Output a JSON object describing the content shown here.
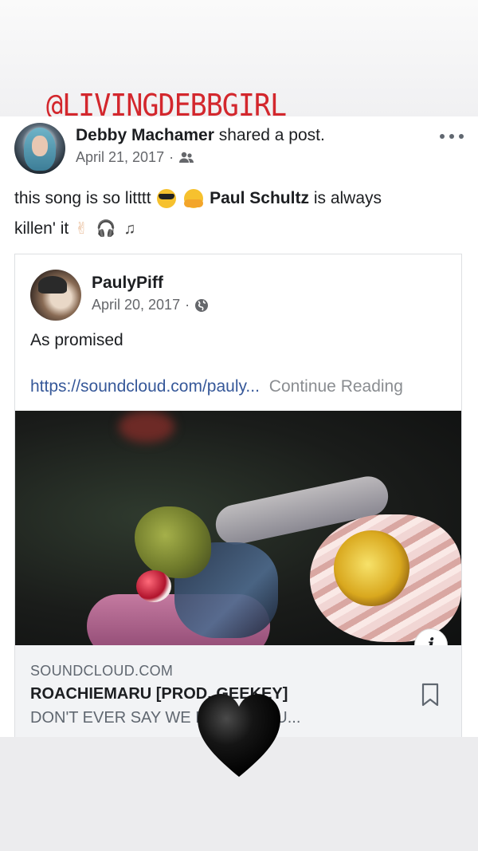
{
  "overlay": {
    "tag": "@LIVINGDEBBGIRL"
  },
  "post": {
    "author": "Debby Machamer",
    "action": "shared a post.",
    "date": "April 21, 2017",
    "audience_icon": "friends-icon",
    "caption_part1": "this song is so litttt",
    "caption_mention": "Paul Schultz",
    "caption_part2": "is always",
    "caption_part3": "killen' it",
    "emojis": [
      "sunglasses-emoji",
      "hugging-emoji",
      "rock-hand-emoji",
      "headphones-emoji",
      "music-notes-emoji"
    ]
  },
  "shared": {
    "author": "PaulyPiff",
    "date": "April 20, 2017",
    "audience_icon": "globe-icon",
    "text": "As promised",
    "link": "https://soundcloud.com/pauly...",
    "continue_label": "Continue Reading",
    "info_label": "i",
    "link_domain": "SOUNDCLOUD.COM",
    "link_title": "ROACHIEMARU [PROD. GEEKEY]",
    "link_description": "DON'T EVER SAY WE      ME. INSTRU..."
  },
  "sticker": {
    "icon": "black-heart-icon",
    "color": "#111111"
  },
  "colors": {
    "tag_red": "#d3272d",
    "link_blue": "#365899",
    "meta_gray": "#65676b"
  }
}
